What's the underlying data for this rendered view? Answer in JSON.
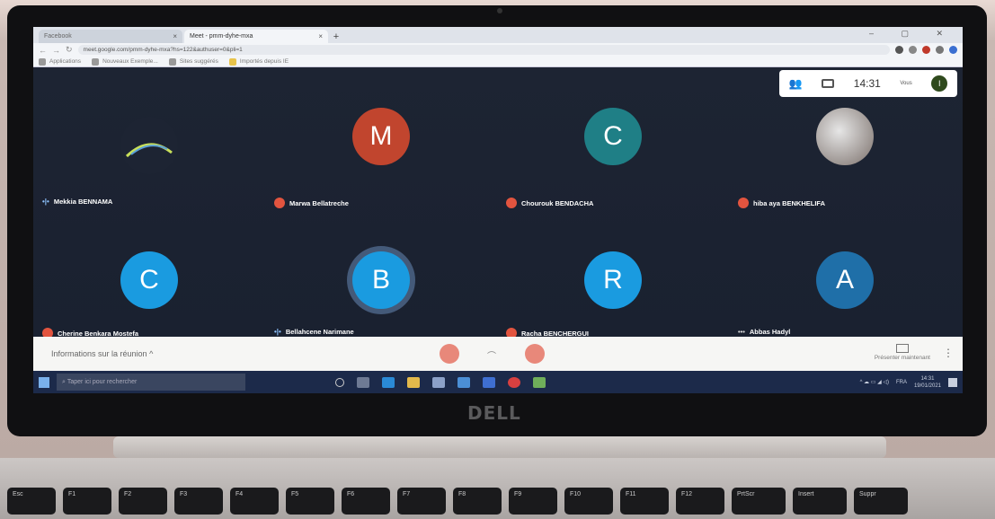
{
  "browser": {
    "tabs": [
      {
        "label": "Facebook",
        "active": false
      },
      {
        "label": "Meet - pmm-dyhe-mxa",
        "active": true
      }
    ],
    "url": "meet.google.com/pmm-dyhe-mxa?hs=122&authuser=0&pli=1",
    "bookmarks": [
      "Applications",
      "Nouveaux Exemple...",
      "Sites suggérés",
      "Importés depuis IE"
    ]
  },
  "meet": {
    "clock": "14:31",
    "self_label": "Vous",
    "self_initial": "I",
    "participants": [
      {
        "name": "Mekkia BENNAMA",
        "initial": "",
        "color": "#1d2433",
        "mic": "on"
      },
      {
        "name": "Marwa Bellatreche",
        "initial": "M",
        "color": "#c1452e",
        "mic": "off"
      },
      {
        "name": "Chourouk BENDACHA",
        "initial": "C",
        "color": "#1f7f86",
        "mic": "off"
      },
      {
        "name": "hiba aya BENKHELIFA",
        "initial": "",
        "color": "#d7d7d7",
        "mic": "off"
      },
      {
        "name": "Cherine Benkara Mostefa",
        "initial": "C",
        "color": "#1a9be0",
        "mic": "off"
      },
      {
        "name": "Bellahcene Narimane",
        "initial": "B",
        "color": "#1a9be0",
        "mic": "on"
      },
      {
        "name": "Racha BENCHERGUI",
        "initial": "R",
        "color": "#1a9be0",
        "mic": "off"
      },
      {
        "name": "Abbas Hadyl",
        "initial": "A",
        "color": "#1f6fa8",
        "mic": "dots"
      }
    ],
    "meeting_info": "Informations sur la réunion",
    "present_now": "Présenter maintenant"
  },
  "taskbar": {
    "search_placeholder": "Taper ici pour rechercher",
    "lang": "FRA",
    "time": "14:31",
    "date": "19/01/2021"
  },
  "laptop": {
    "logo": "DELL",
    "keys": [
      "Esc",
      "F1",
      "F2",
      "F3",
      "F4",
      "F5",
      "F6",
      "F7",
      "F8",
      "F9",
      "F10",
      "F11",
      "F12",
      "PrtScr",
      "Insert",
      "Suppr"
    ]
  }
}
